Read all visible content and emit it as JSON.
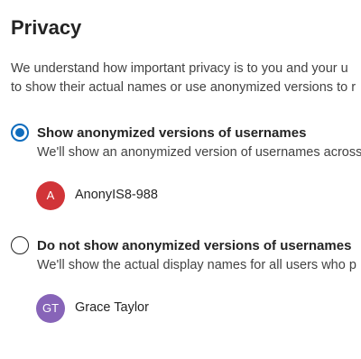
{
  "title": "Privacy",
  "description": {
    "line1": "We understand how important privacy is to you and your u",
    "line2": "to show their actual names or use anonymized versions to r"
  },
  "options": [
    {
      "label": "Show anonymized versions of usernames",
      "description": "We'll show an anonymized version of usernames across",
      "selected": true,
      "example": {
        "initials": "A",
        "name": "AnonyIS8-988",
        "avatar_color": "#d13438"
      }
    },
    {
      "label": "Do not show anonymized versions of usernames",
      "description": "We'll show the actual display names for all users who p",
      "selected": false,
      "example": {
        "initials": "GT",
        "name": "Grace Taylor",
        "avatar_color": "#8764b8"
      }
    }
  ],
  "colors": {
    "accent": "#0f6cbd"
  }
}
